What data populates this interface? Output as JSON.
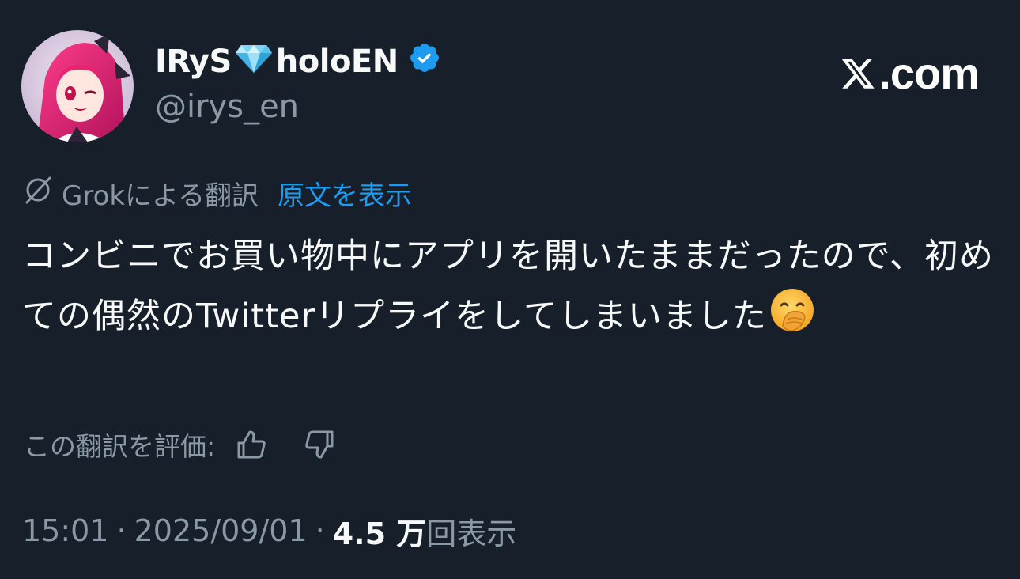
{
  "author": {
    "display_name_part1": "IRyS",
    "display_name_emoji": "gem-stone-emoji",
    "display_name_part2": "holoEN",
    "verified_icon": "verified-badge-icon",
    "handle": "@irys_en",
    "avatar": "avatar-image"
  },
  "brand": {
    "label": ".com",
    "icon": "x-logo-icon"
  },
  "translation": {
    "icon": "grok-icon",
    "label": "Grokによる翻訳",
    "show_original": "原文を表示"
  },
  "tweet": {
    "text": "コンビニでお買い物中にアプリを開いたままだったので、初めての偶然のTwitterリプライをしてしまいました",
    "emoji": "face-with-hand-over-mouth-emoji"
  },
  "rating": {
    "label": "この翻訳を評価:",
    "thumbs_up_icon": "thumbs-up-icon",
    "thumbs_down_icon": "thumbs-down-icon"
  },
  "meta": {
    "time": "15:01",
    "separator": "·",
    "date": "2025/09/01",
    "views_count": "4.5 万",
    "views_label": "回表示"
  },
  "colors": {
    "background": "#17202a",
    "primary_text": "#f7f9f9",
    "secondary_text": "#8b98a5",
    "link": "#1d9bf0",
    "verified": "#1d9bf0"
  }
}
